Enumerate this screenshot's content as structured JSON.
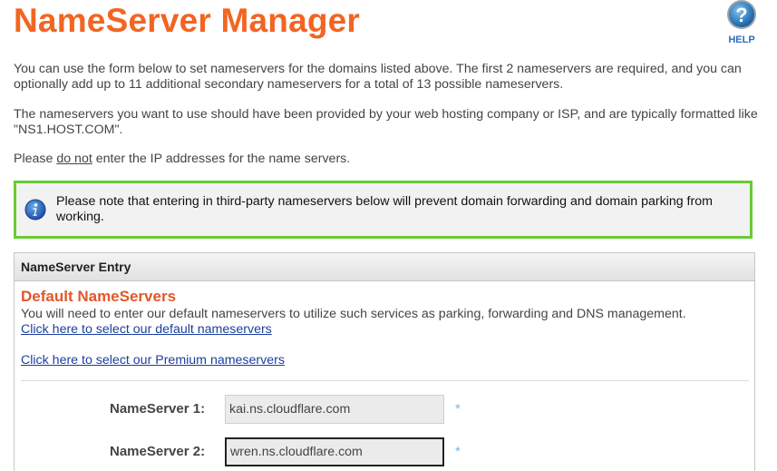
{
  "page": {
    "title": "NameServer Manager",
    "help_label": "HELP"
  },
  "intro": {
    "p1": "You can use the form below to set nameservers for the domains listed above. The first 2 nameservers are required, and you can optionally add up to 11 additional secondary nameservers for a total of 13 possible nameservers.",
    "p2": "The nameservers you want to use should have been provided by your web hosting company or ISP, and are typically formatted like \"NS1.HOST.COM\".",
    "p3_before": "Please ",
    "p3_underlined": "do not",
    "p3_after": " enter the IP addresses for the name servers."
  },
  "notice": {
    "text": "Please note that entering in third-party nameservers below will prevent domain forwarding and domain parking from working.",
    "icon": "info-icon",
    "border_color": "#66cc33"
  },
  "panel": {
    "header": "NameServer Entry",
    "section_title": "Default NameServers",
    "section_desc": "You will need to enter our default nameservers to utilize such services as parking, forwarding and DNS management.",
    "link_default": "Click here to select our default nameservers",
    "link_premium": "Click here to select our Premium nameservers",
    "nameservers": [
      {
        "label": "NameServer 1:",
        "value": "kai.ns.cloudflare.com",
        "required_mark": "*"
      },
      {
        "label": "NameServer 2:",
        "value": "wren.ns.cloudflare.com",
        "required_mark": "*"
      }
    ]
  },
  "colors": {
    "title": "#f26522",
    "section_title": "#e2572a",
    "link": "#1a3f9e",
    "help": "#2a6ebb"
  }
}
